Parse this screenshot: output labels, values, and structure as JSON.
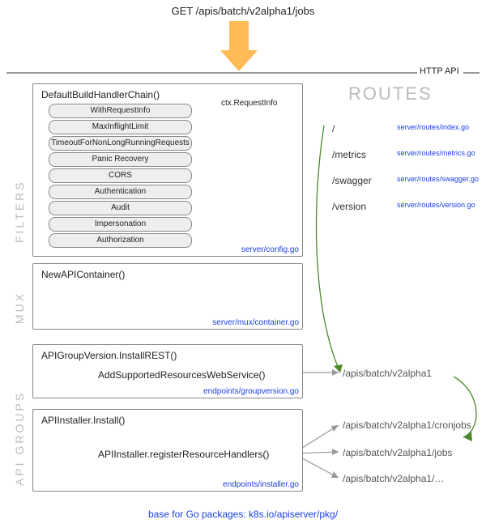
{
  "header": {
    "request": "GET /apis/batch/v2alpha1/jobs",
    "api_label": "HTTP API"
  },
  "routes_heading": "ROUTES",
  "sections": {
    "filters": "FILTERS",
    "mux": "MUX",
    "api_groups": "API GROUPS"
  },
  "filters_box": {
    "title": "DefaultBuildHandlerChain()",
    "ctx_label": "ctx.RequestInfo",
    "items": [
      "WithRequestInfo",
      "MaxInflightLimit",
      "TimeoutForNonLongRunningRequests",
      "Panic Recovery",
      "CORS",
      "Authentication",
      "Audit",
      "Impersonation",
      "Authorization"
    ],
    "source": "server/config.go"
  },
  "mux_box": {
    "title": "NewAPIContainer()",
    "source": "server/mux/container.go"
  },
  "group_box": {
    "title": "APIGroupVersion.InstallREST()",
    "call": "AddSupportedResourcesWebService()",
    "source": "endpoints/groupversion.go",
    "endpoint": "/apis/batch/v2alpha1"
  },
  "installer_box": {
    "title": "APIInstaller.Install()",
    "call": "APIInstaller.registerResourceHandlers()",
    "source": "endpoints/installer.go",
    "endpoints": [
      "/apis/batch/v2alpha1/cronjobs",
      "/apis/batch/v2alpha1/jobs",
      "/apis/batch/v2alpha1/…"
    ]
  },
  "routes": [
    {
      "path": "/",
      "file": "server/routes/index.go"
    },
    {
      "path": "/metrics",
      "file": "server/routes/metrics.go"
    },
    {
      "path": "/swagger",
      "file": "server/routes/swagger.go"
    },
    {
      "path": "/version",
      "file": "server/routes/version.go"
    }
  ],
  "footer": "base for Go packages: k8s.io/apiserver/pkg/"
}
